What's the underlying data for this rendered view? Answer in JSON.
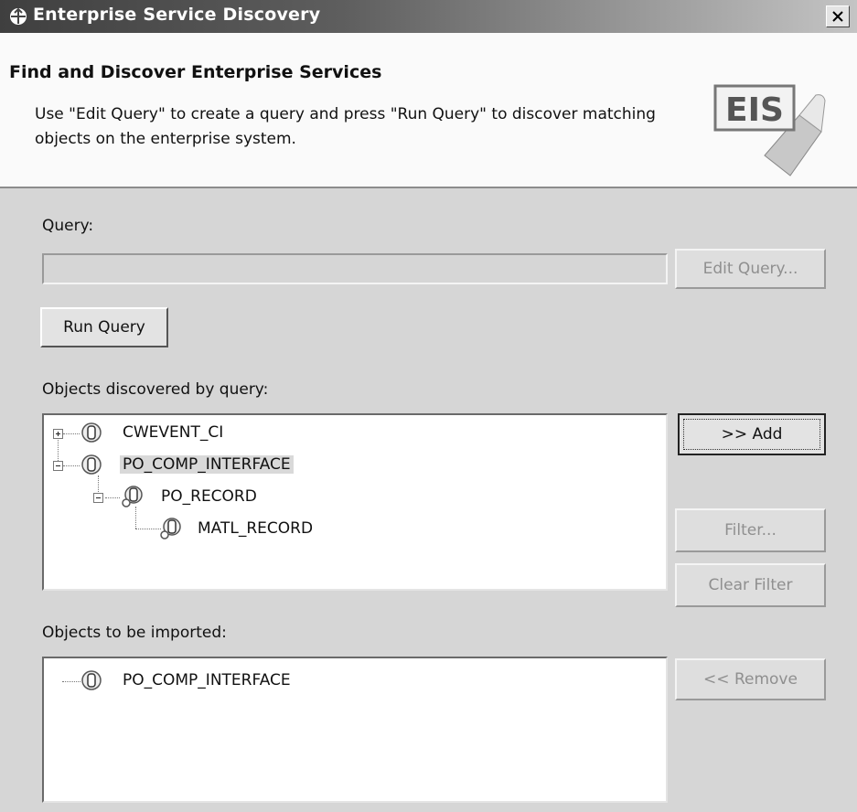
{
  "window": {
    "title": "Enterprise Service Discovery"
  },
  "banner": {
    "heading": "Find and Discover Enterprise Services",
    "description": "Use \"Edit Query\" to create a query and press \"Run Query\" to discover matching objects on the enterprise system.",
    "graphic_label": "EIS"
  },
  "query": {
    "label": "Query:",
    "value": "",
    "edit_button": "Edit Query...",
    "run_button": "Run Query"
  },
  "discovered": {
    "label": "Objects discovered by query:",
    "items": [
      {
        "label": "CWEVENT_CI",
        "expanded": false,
        "icon": "business-object-icon"
      },
      {
        "label": "PO_COMP_INTERFACE",
        "expanded": true,
        "selected": true,
        "icon": "business-object-icon"
      },
      {
        "label": "PO_RECORD",
        "expanded": true,
        "icon": "child-object-icon"
      },
      {
        "label": "MATL_RECORD",
        "icon": "child-object-icon"
      }
    ],
    "add_button": ">> Add",
    "filter_button": "Filter...",
    "clear_filter_button": "Clear Filter"
  },
  "imported": {
    "label": "Objects to be imported:",
    "items": [
      {
        "label": "PO_COMP_INTERFACE",
        "icon": "business-object-icon"
      }
    ],
    "remove_button": "<< Remove"
  },
  "colors": {
    "background": "#d6d6d6",
    "title_dark": "#3f3f3f",
    "banner": "#fafafa"
  }
}
